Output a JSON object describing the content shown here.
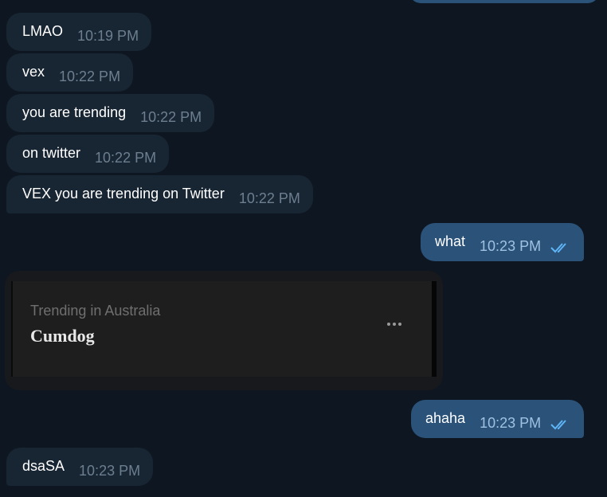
{
  "messages": [
    {
      "text": "LMAO",
      "time": "10:19 PM",
      "dir": "in"
    },
    {
      "text": "vex",
      "time": "10:22 PM",
      "dir": "in"
    },
    {
      "text": "you are trending",
      "time": "10:22 PM",
      "dir": "in"
    },
    {
      "text": "on twitter",
      "time": "10:22 PM",
      "dir": "in"
    },
    {
      "text": "VEX you are trending on Twitter",
      "time": "10:22 PM",
      "dir": "in"
    },
    {
      "text": "what",
      "time": "10:23 PM",
      "dir": "out"
    },
    {
      "text": "ahaha",
      "time": "10:23 PM",
      "dir": "out"
    },
    {
      "text": "dsaSA",
      "time": "10:23 PM",
      "dir": "in"
    }
  ],
  "embedded_image": {
    "subtitle": "Trending in Australia",
    "title": "Cumdog",
    "menu_icon": "more-dots-icon"
  },
  "colors": {
    "background": "#0e1621",
    "incoming_bubble": "#182533",
    "outgoing_bubble": "#2b5278",
    "read_checks": "#5eb5f7"
  },
  "icons": {
    "read_receipt": "double-check-icon"
  }
}
